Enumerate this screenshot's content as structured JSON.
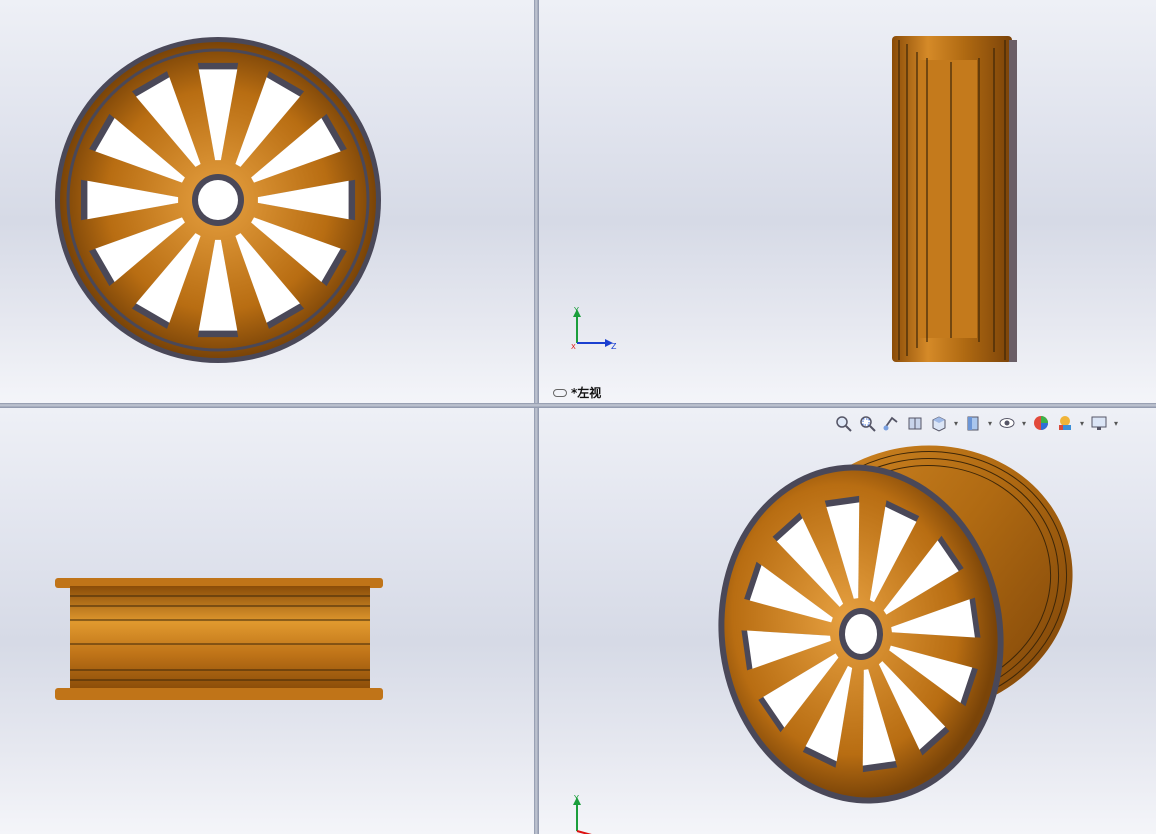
{
  "viewports": {
    "top_left": {
      "name": "front-view"
    },
    "top_right": {
      "name": "left-view",
      "label": "*左视"
    },
    "bottom_left": {
      "name": "top-view"
    },
    "bottom_right": {
      "name": "isometric-view"
    }
  },
  "triad": {
    "y_axis": "Y",
    "z_axis": "Z",
    "x_axis": "X"
  },
  "toolbar": {
    "icons": [
      "zoom-to-fit-icon",
      "zoom-to-area-icon",
      "previous-view-icon",
      "section-view-icon",
      "view-orientation-icon",
      "display-style-icon",
      "hide-show-items-icon",
      "edit-appearance-icon",
      "apply-scene-icon",
      "view-settings-icon"
    ]
  },
  "colors": {
    "rim_gold": "#c77a1a",
    "rim_dark": "#4b4a5c",
    "accent_blue": "#1a3fd0",
    "axis_green": "#1b9e3c",
    "axis_red": "#d11"
  }
}
